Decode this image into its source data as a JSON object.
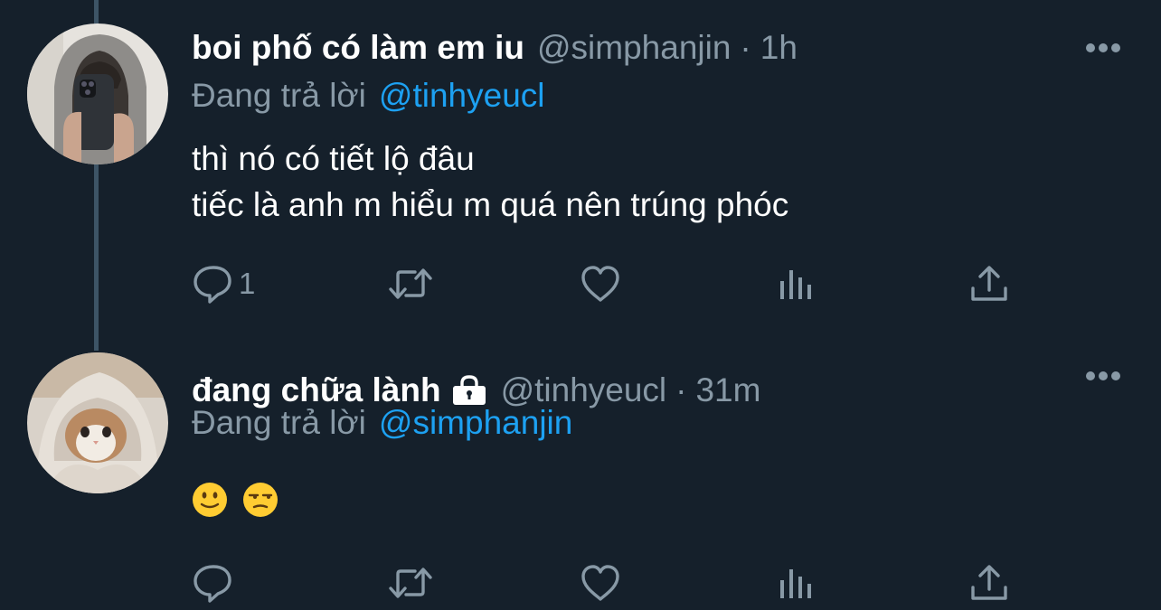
{
  "tweets": [
    {
      "display_name": "boi phố có làm em iu",
      "handle": "@simphanjin",
      "separator": "·",
      "time": "1h",
      "reply_prefix": "Đang trả lời",
      "reply_to": "@tinhyeucl",
      "body_lines": [
        "thì nó có tiết lộ đâu",
        "tiếc là anh m hiểu m quá nên trúng phóc"
      ],
      "reply_count": "1",
      "avatar_icon": "person-holding-phone-avatar"
    },
    {
      "display_name": "đang chữa lành",
      "handle": "@tinhyeucl",
      "separator": "·",
      "time": "31m",
      "reply_prefix": "Đang trả lời",
      "reply_to": "@simphanjin",
      "emojis": [
        "slightly-smiling-face",
        "unamused-face"
      ],
      "reply_count": "",
      "protected": true,
      "avatar_icon": "cat-in-blanket-avatar"
    }
  ],
  "colors": {
    "background": "#15202b",
    "secondary_text": "#8899a6",
    "link": "#1da1f2",
    "thread_line": "#3d5466"
  }
}
